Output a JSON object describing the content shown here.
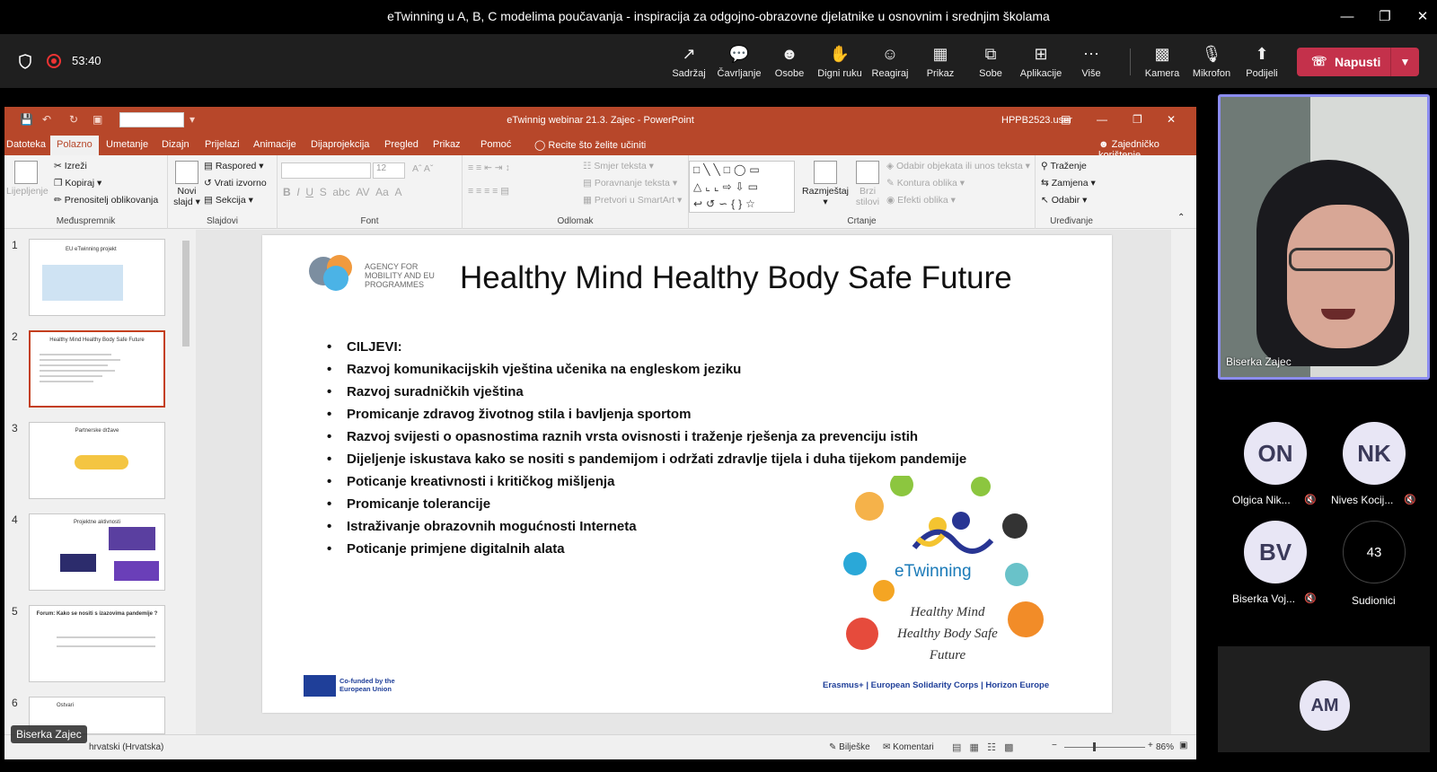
{
  "window": {
    "title": "eTwinning u A, B, C modelima poučavanja - inspiracija za odgojno-obrazovne djelatnike u osnovnim i srednjim školama"
  },
  "meeting": {
    "timer": "53:40",
    "toolbar": [
      {
        "label": "Sadržaj",
        "icon": "content-icon"
      },
      {
        "label": "Čavrljanje",
        "icon": "chat-icon"
      },
      {
        "label": "Osobe",
        "icon": "people-icon"
      },
      {
        "label": "Digni ruku",
        "icon": "raise-hand-icon"
      },
      {
        "label": "Reagiraj",
        "icon": "react-icon"
      },
      {
        "label": "Prikaz",
        "icon": "view-icon"
      },
      {
        "label": "Sobe",
        "icon": "rooms-icon"
      },
      {
        "label": "Aplikacije",
        "icon": "apps-icon"
      },
      {
        "label": "Više",
        "icon": "more-icon"
      },
      {
        "label": "Kamera",
        "icon": "camera-off-icon"
      },
      {
        "label": "Mikrofon",
        "icon": "mic-off-icon"
      },
      {
        "label": "Podijeli",
        "icon": "share-icon"
      }
    ],
    "leave_label": "Napusti"
  },
  "powerpoint": {
    "title": "eTwinnig webinar 21.3. Zajec  -  PowerPoint",
    "user": "HPPB2523.user",
    "tabs": [
      "Datoteka",
      "Polazno",
      "Umetanje",
      "Dizajn",
      "Prijelazi",
      "Animacije",
      "Dijaprojekcija",
      "Pregled",
      "Prikaz",
      "Pomoć"
    ],
    "active_tab": "Polazno",
    "tell_me": "Recite što želite učiniti",
    "share": "Zajedničko korištenje",
    "ribbon": {
      "clipboard": {
        "paste": "Lijepljenje",
        "cut": "Izreži",
        "copy": "Kopiraj",
        "format_painter": "Prenositelj oblikovanja",
        "label": "Međuspremnik"
      },
      "slides": {
        "new_slide_1": "Novi",
        "new_slide_2": "slajd",
        "layout": "Raspored",
        "reset": "Vrati izvorno",
        "section": "Sekcija",
        "label": "Slajdovi"
      },
      "font": {
        "size": "12",
        "label": "Font"
      },
      "paragraph": {
        "text_direction": "Smjer teksta",
        "align_text": "Poravnanje teksta",
        "smartart": "Pretvori u SmartArt",
        "label": "Odlomak"
      },
      "drawing": {
        "arrange": "Razmještaj",
        "quick_styles_1": "Brzi",
        "quick_styles_2": "stilovi",
        "fill": "Odabir objekata ili unos teksta",
        "outline": "Kontura oblika",
        "effects": "Efekti oblika",
        "label": "Crtanje"
      },
      "editing": {
        "find": "Traženje",
        "replace": "Zamjena",
        "select": "Odabir",
        "label": "Uređivanje"
      }
    },
    "thumbnails": [
      {
        "num": "1",
        "title": "EU eTwinning projekt"
      },
      {
        "num": "2",
        "title": "Healthy Mind Healthy Body Safe Future"
      },
      {
        "num": "3",
        "title": "Partnerske države"
      },
      {
        "num": "4",
        "title": "Projektne aktivnosti"
      },
      {
        "num": "5",
        "title": "Forum: Kako se nositi s izazovima pandemije ?"
      },
      {
        "num": "6",
        "title": "Ostvari"
      }
    ],
    "slide": {
      "agency": "AGENCY FOR MOBILITY AND EU PROGRAMMES",
      "title": "Healthy Mind Healthy Body Safe Future",
      "heading": "CILJEVI:",
      "bullets": [
        "Razvoj komunikacijskih vještina učenika na engleskom jeziku",
        "Razvoj suradničkih vještina",
        "Promicanje zdravog životnog stila i bavljenja sportom",
        "Razvoj svijesti o opasnostima raznih vrsta ovisnosti i traženje rješenja za prevenciju istih",
        "Dijeljenje iskustava kako se nositi s pandemijom i održati zdravlje tijela i duha tijekom pandemije",
        "Poticanje kreativnosti i kritičkog mišljenja",
        "Promicanje tolerancije",
        "Istraživanje obrazovnih mogućnosti Interneta",
        "Poticanje primjene digitalnih alata"
      ],
      "etwinning": "eTwinning",
      "logo_caption": [
        "Healthy Mind",
        "Healthy Body Safe",
        "Future"
      ],
      "eu_funding": "Co-funded by the European Union",
      "footer_right": "Erasmus+  |  European Solidarity Corps  |  Horizon Europe"
    },
    "status": {
      "language": "hrvatski (Hrvatska)",
      "notes": "Bilješke",
      "comments": "Komentari",
      "zoom": "86%"
    }
  },
  "presenter_badge": "Biserka Zajec",
  "participants": {
    "video_name": "Biserka Zajec",
    "tiles": [
      {
        "initials": "ON",
        "name": "Olgica Nik..."
      },
      {
        "initials": "NK",
        "name": "Nives Kocij..."
      },
      {
        "initials": "BV",
        "name": "Biserka Voj..."
      }
    ],
    "count": "43",
    "count_label": "Sudionici",
    "extra_initials": "AM"
  }
}
